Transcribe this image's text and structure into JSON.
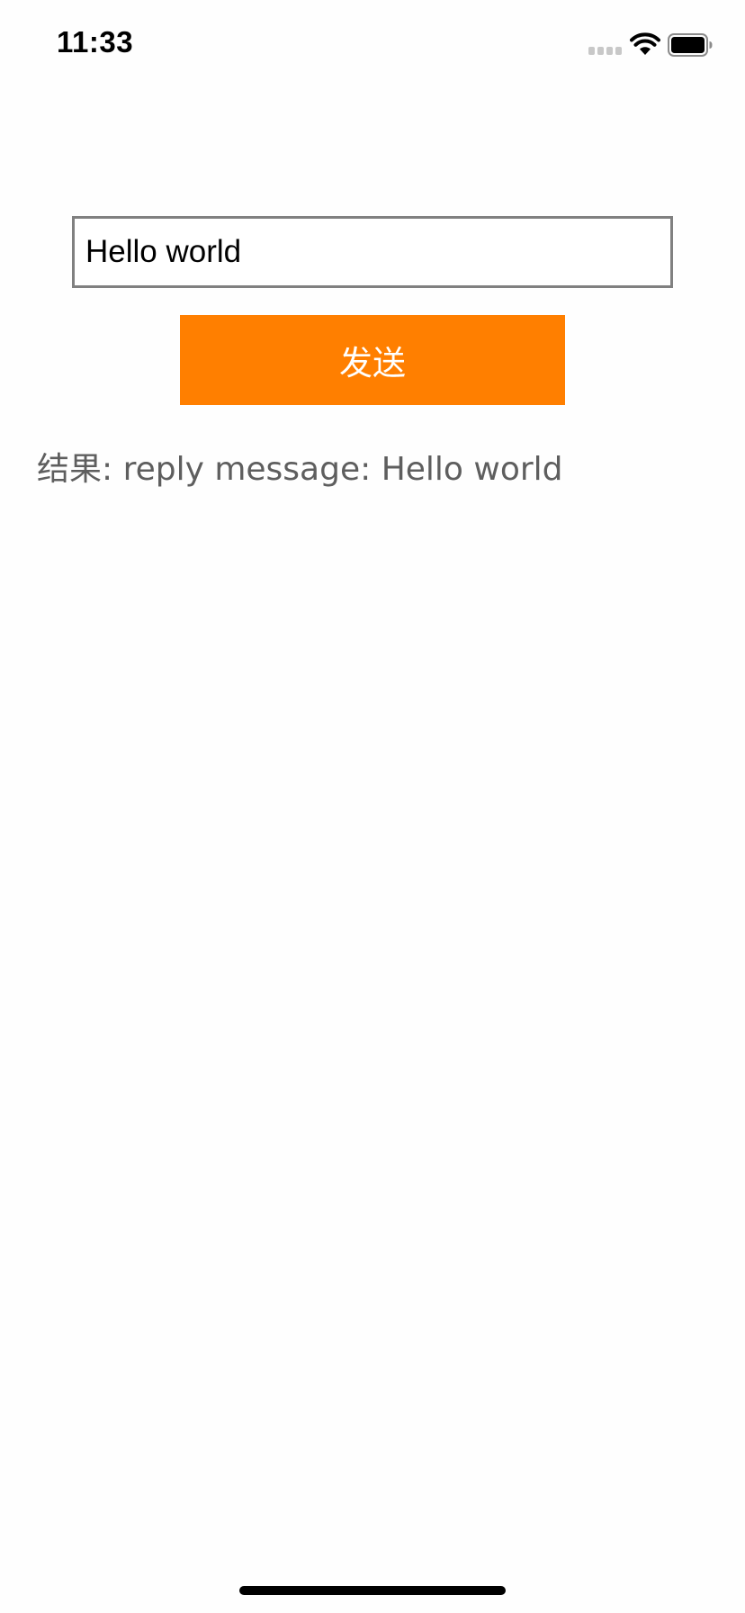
{
  "status_bar": {
    "time": "11:33",
    "icons": [
      "cellular-signal-icon",
      "wifi-icon",
      "battery-icon"
    ]
  },
  "form": {
    "input_value": "Hello world",
    "send_label": "发送"
  },
  "result": {
    "text": "结果: reply message: Hello world"
  },
  "colors": {
    "accent": "#ff7f00",
    "input_border": "#808080",
    "result_text": "#5e5e5e",
    "background": "#fefefe"
  }
}
